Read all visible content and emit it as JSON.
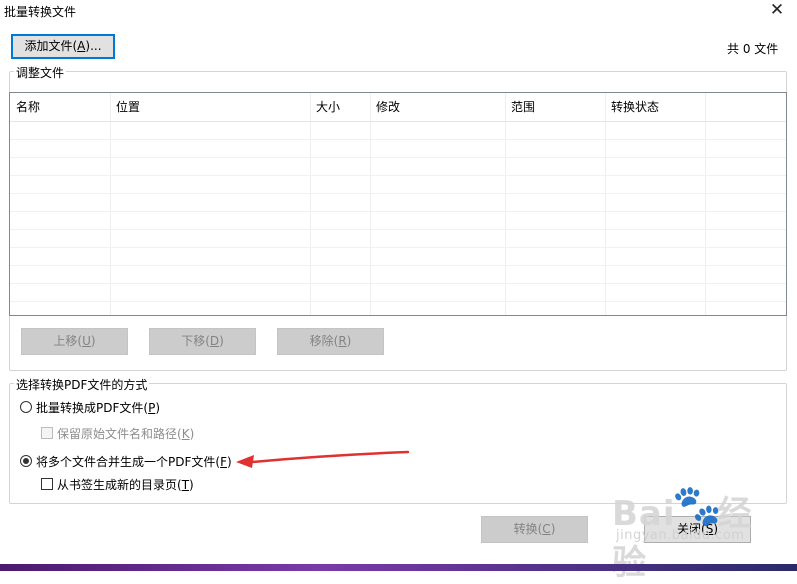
{
  "window": {
    "title": "批量转换文件",
    "close_glyph": "✕"
  },
  "toolbar": {
    "add_files_label": "添加文件(",
    "add_files_key": "A",
    "add_files_suffix": ")...",
    "file_count": "共 0 文件"
  },
  "adjust_group": {
    "legend": "调整文件",
    "columns": [
      "名称",
      "位置",
      "大小",
      "修改",
      "范围",
      "转换状态"
    ],
    "move_up": {
      "label": "上移(",
      "key": "U",
      "suffix": ")"
    },
    "move_down": {
      "label": "下移(",
      "key": "D",
      "suffix": ")"
    },
    "remove": {
      "label": "移除(",
      "key": "R",
      "suffix": ")"
    }
  },
  "mode_group": {
    "legend": "选择转换PDF文件的方式",
    "batch_option": {
      "label": "批量转换成PDF文件(",
      "key": "P",
      "suffix": ")",
      "checked": false
    },
    "keep_names_option": {
      "label": "保留原始文件名和路径(",
      "key": "K",
      "suffix": ")",
      "enabled": false
    },
    "merge_option": {
      "label": "将多个文件合并生成一个PDF文件(",
      "key": "F",
      "suffix": ")",
      "checked": true
    },
    "toc_option": {
      "label": "从书签生成新的目录页(",
      "key": "T",
      "suffix": ")",
      "checked": false
    }
  },
  "footer": {
    "convert": {
      "label": "转换(",
      "key": "C",
      "suffix": ")"
    },
    "close": {
      "label": "关闭(",
      "key": "S",
      "suffix": ")"
    }
  },
  "watermark": {
    "brand": "Bai",
    "brand_end": "经验",
    "url": "jingyan.baidu.com"
  },
  "colors": {
    "annotation_arrow": "#e03030",
    "focus_border": "#0078d7"
  }
}
